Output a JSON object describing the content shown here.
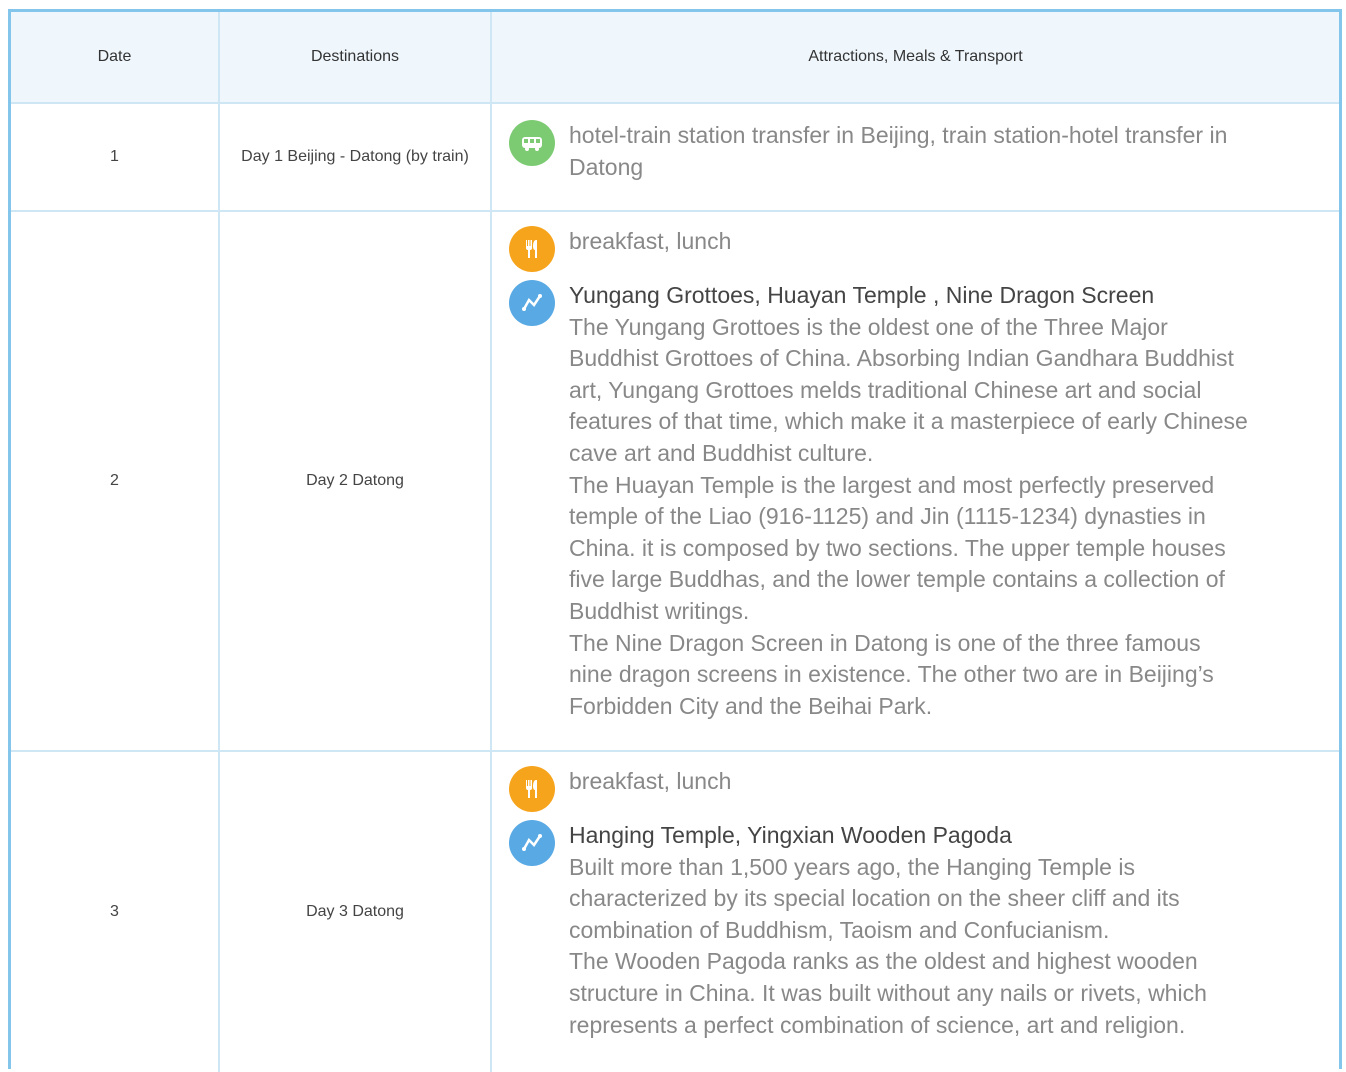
{
  "table": {
    "headers": [
      "Date",
      "Destinations",
      "Attractions, Meals & Transport"
    ],
    "rows": [
      {
        "date": "1",
        "destination": "Day 1 Beijing - Datong (by train)",
        "transport": "hotel-train station transfer in Beijing, train station-hotel transfer in Datong"
      },
      {
        "date": "2",
        "destination": "Day 2 Datong",
        "meals": "breakfast, lunch",
        "attractions_title": "Yungang Grottoes, Huayan Temple , Nine Dragon Screen",
        "paragraphs": [
          "The Yungang Grottoes is the oldest one of the Three Major Buddhist Grottoes of China. Absorbing Indian Gandhara Buddhist art, Yungang Grottoes melds traditional Chinese art and social features of that time, which make it a masterpiece of early Chinese cave art and Buddhist culture.",
          "The Huayan Temple is the largest and most perfectly preserved temple of the Liao (916-1125) and Jin (1115-1234) dynasties in China. it is composed by two sections. The upper temple houses five large Buddhas, and the lower temple contains a collection of Buddhist writings.",
          "The Nine Dragon Screen in Datong is one of the three famous nine dragon screens in existence. The other two are in Beijing’s Forbidden City and the Beihai Park."
        ]
      },
      {
        "date": "3",
        "destination": "Day 3 Datong",
        "meals": "breakfast, lunch",
        "attractions_title": "Hanging Temple, Yingxian Wooden Pagoda",
        "paragraphs": [
          "Built more than 1,500 years ago, the Hanging Temple is characterized by its special location on the sheer cliff and its combination of Buddhism, Taoism and Confucianism.",
          "The Wooden Pagoda ranks as the oldest and highest wooden structure in China. It was built without any nails or rivets, which represents a perfect combination of science, art and religion."
        ]
      }
    ]
  },
  "icons": {
    "transport": "bus-icon",
    "meals": "fork-knife-icon",
    "attractions": "route-icon"
  },
  "colors": {
    "border": "#84c5ec",
    "header_bg": "#eff7fd",
    "bus": "#7ccb73",
    "meals": "#f7a41d",
    "attractions": "#58a9e4"
  }
}
